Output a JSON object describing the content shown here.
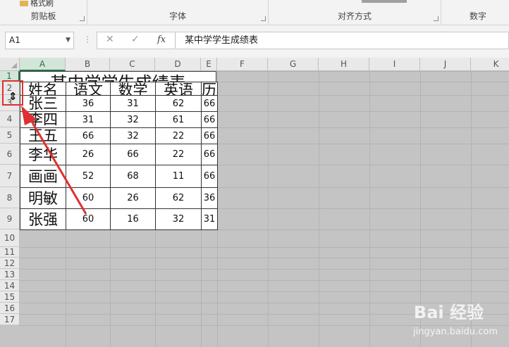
{
  "ribbon": {
    "format_painter_label": "格式刷",
    "groups": [
      "剪贴板",
      "字体",
      "对齐方式",
      "数字"
    ]
  },
  "formula_bar": {
    "name_box": "A1",
    "cancel_symbol": "✕",
    "enter_symbol": "✓",
    "fx_label": "fx",
    "formula": "某中学学生成绩表"
  },
  "columns": [
    "A",
    "B",
    "C",
    "D",
    "E",
    "F",
    "G",
    "H",
    "I",
    "J",
    "K"
  ],
  "rows": [
    "1",
    "2",
    "3",
    "4",
    "5",
    "6",
    "7",
    "8",
    "9",
    "10",
    "11",
    "12",
    "13",
    "14",
    "15",
    "16",
    "17"
  ],
  "sheet": {
    "title": "某中学学生成绩表",
    "headers": [
      "姓名",
      "语文",
      "数学",
      "英语",
      "历史"
    ],
    "records": [
      {
        "name": "张三",
        "scores": [
          "36",
          "31",
          "62",
          "66"
        ]
      },
      {
        "name": "李四",
        "scores": [
          "31",
          "32",
          "61",
          "66"
        ]
      },
      {
        "name": "王五",
        "scores": [
          "66",
          "32",
          "22",
          "66"
        ]
      },
      {
        "name": "李华",
        "scores": [
          "26",
          "66",
          "22",
          "66"
        ]
      },
      {
        "name": "画画",
        "scores": [
          "52",
          "68",
          "11",
          "66"
        ]
      },
      {
        "name": "明敏",
        "scores": [
          "60",
          "26",
          "62",
          "36"
        ]
      },
      {
        "name": "张强",
        "scores": [
          "60",
          "16",
          "32",
          "31"
        ]
      }
    ]
  },
  "cursor": {
    "symbol": "⇕"
  },
  "watermark": {
    "logo": "Bai 经验",
    "url": "jingyan.baidu.com"
  },
  "colors": {
    "accent": "#217346",
    "annotation": "#e03030",
    "grid_background": "#c4c4c4"
  }
}
